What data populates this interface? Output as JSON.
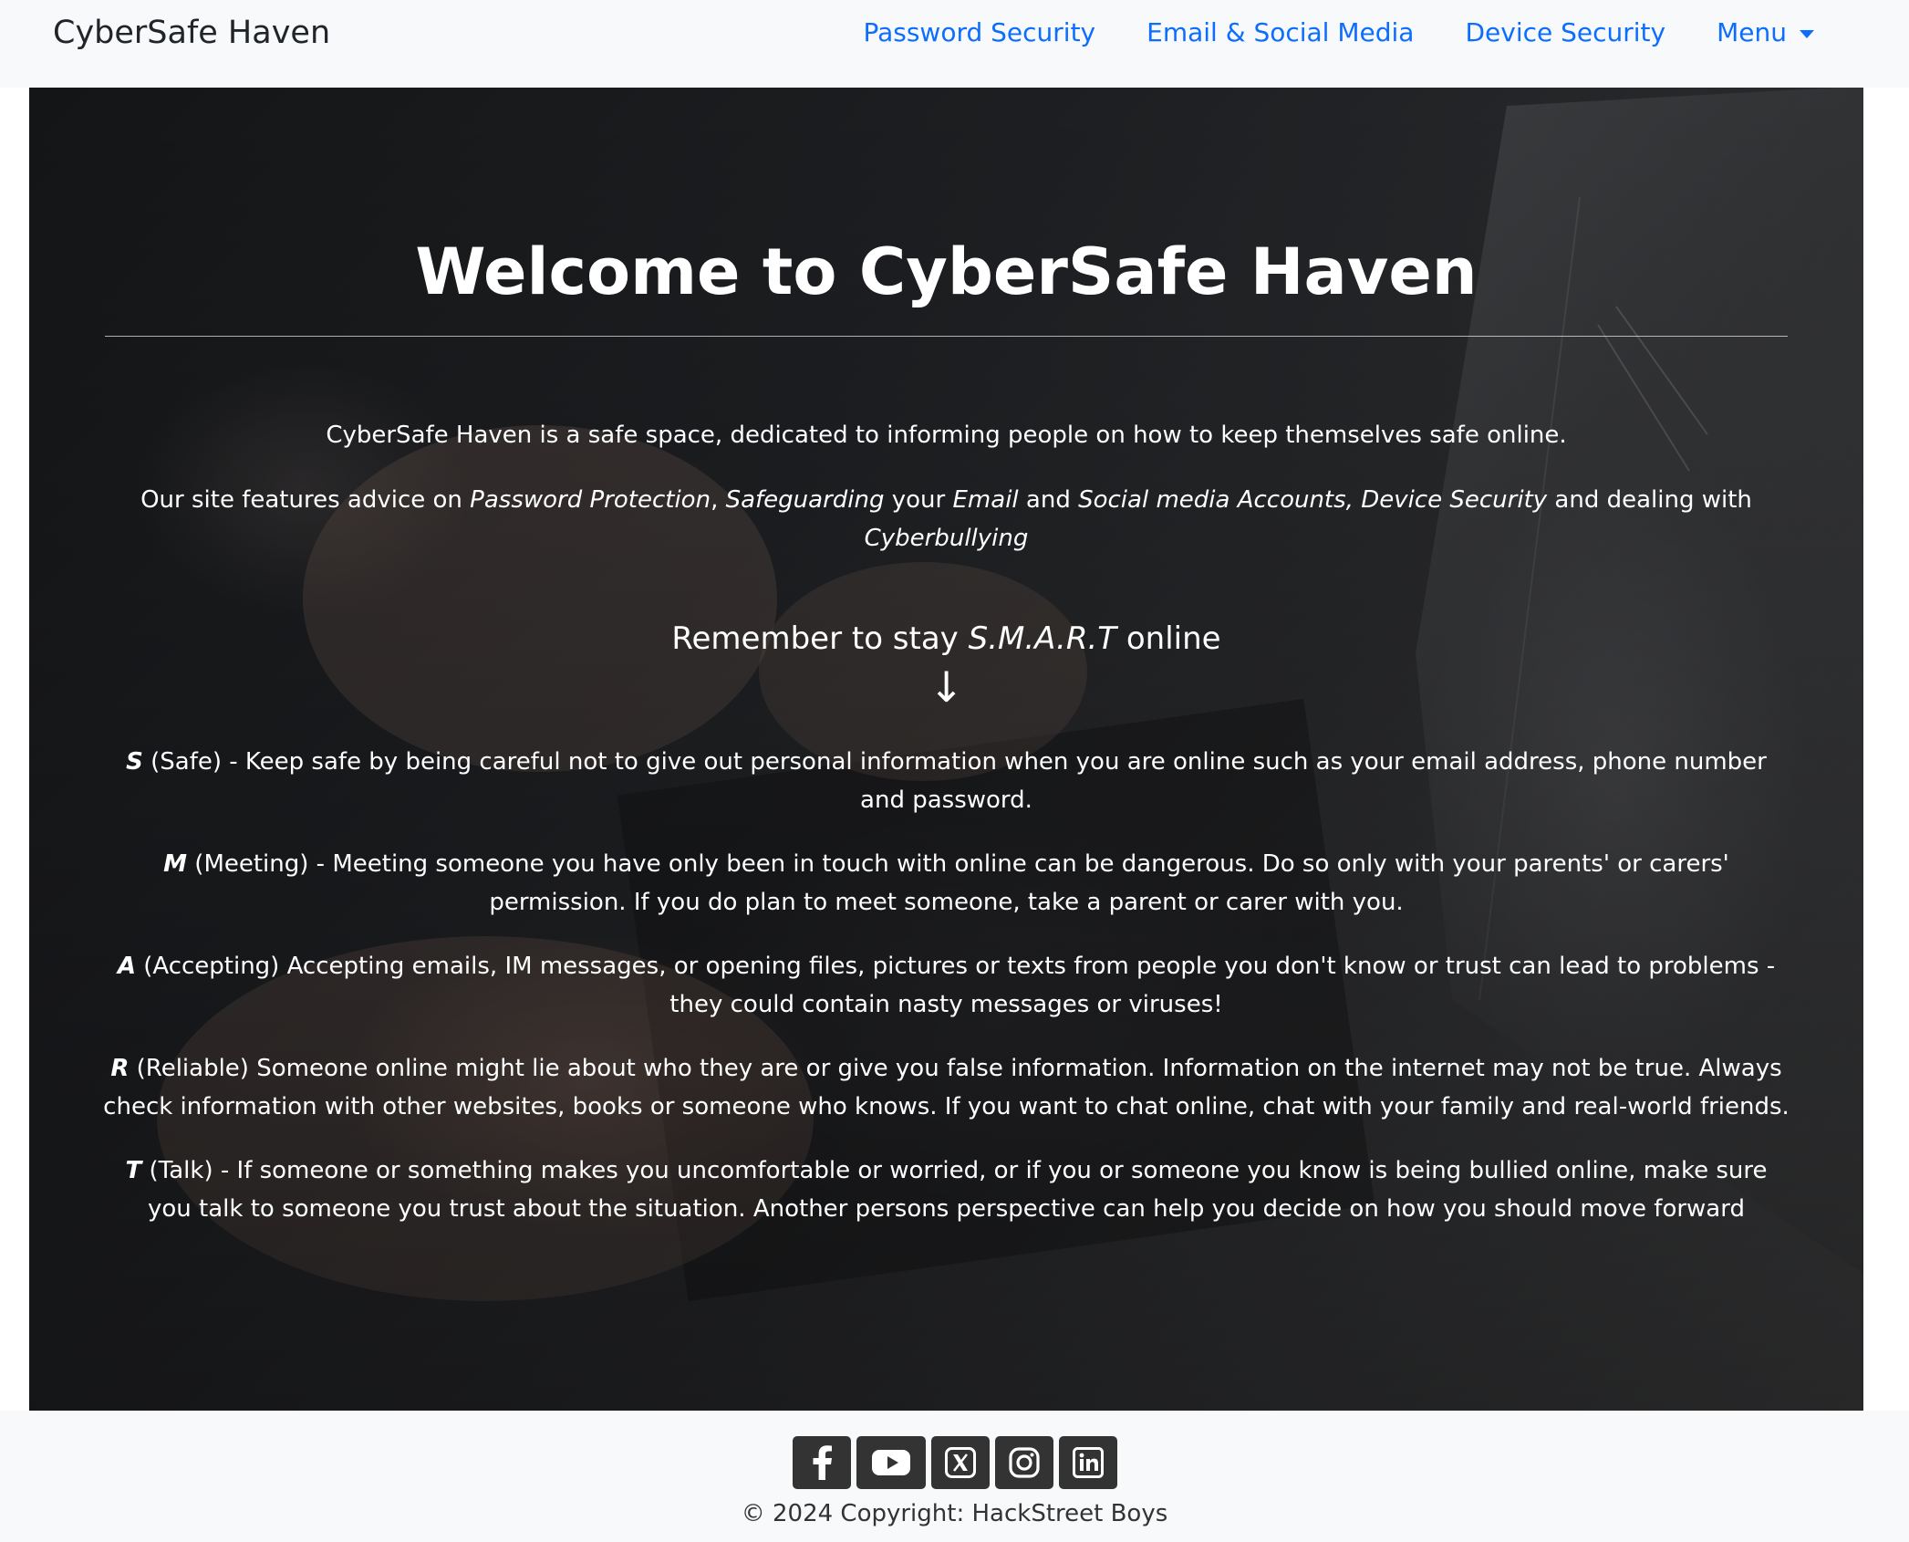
{
  "navbar": {
    "brand": "CyberSafe Haven",
    "links": [
      {
        "label": "Password Security"
      },
      {
        "label": "Email & Social Media"
      },
      {
        "label": "Device Security"
      },
      {
        "label": "Menu"
      }
    ]
  },
  "hero": {
    "title": "Welcome to CyberSafe Haven",
    "intro_1": "CyberSafe Haven is a safe space, dedicated to informing people on how to keep themselves safe online.",
    "intro_2": {
      "prefix": "Our site features advice on ",
      "topic_password": "Password Protection",
      "sep_1": ", ",
      "topic_safeguarding": "Safeguarding",
      "mid_1": " your ",
      "topic_email": "Email",
      "mid_2": " and ",
      "topic_social": "Social media Accounts, Device Security",
      "mid_3": " and dealing with ",
      "topic_cyberbullying": "Cyberbullying"
    },
    "smart_heading": {
      "prefix": "Remember to stay ",
      "acronym": "S.M.A.R.T",
      "suffix": " online"
    },
    "arrow": "↓",
    "smart_items": [
      {
        "letter": "S",
        "text": " (Safe) - Keep safe by being careful not to give out personal information when you are online such as your email address, phone number and password."
      },
      {
        "letter": "M",
        "text": " (Meeting) - Meeting someone you have only been in touch with online can be dangerous. Do so only with your parents' or carers' permission. If you do plan to meet someone, take a parent or carer with you."
      },
      {
        "letter": "A",
        "text": " (Accepting) Accepting emails, IM messages, or opening files, pictures or texts from people you don't know or trust can lead to problems - they could contain nasty messages or viruses!"
      },
      {
        "letter": "R",
        "text": " (Reliable) Someone online might lie about who they are or give you false information. Information on the internet may not be true. Always check information with other websites, books or someone who knows. If you want to chat online, chat with your family and real-world friends."
      },
      {
        "letter": "T",
        "text": " (Talk) - If someone or something makes you uncomfortable or worried, or if you or someone you know is being bullied online, make sure you talk to someone you trust about the situation. Another persons perspective can help you decide on how you should move forward"
      }
    ]
  },
  "footer": {
    "social_icons": [
      "facebook-icon",
      "youtube-icon",
      "x-twitter-icon",
      "instagram-icon",
      "linkedin-icon"
    ],
    "copyright": "© 2024 Copyright: HackStreet Boys"
  },
  "colors": {
    "link": "#0d6efd",
    "navbar_bg": "#f8f9fa",
    "footer_bg": "#f8f9fa",
    "social_button_bg": "#333333",
    "hero_text": "#ffffff"
  }
}
